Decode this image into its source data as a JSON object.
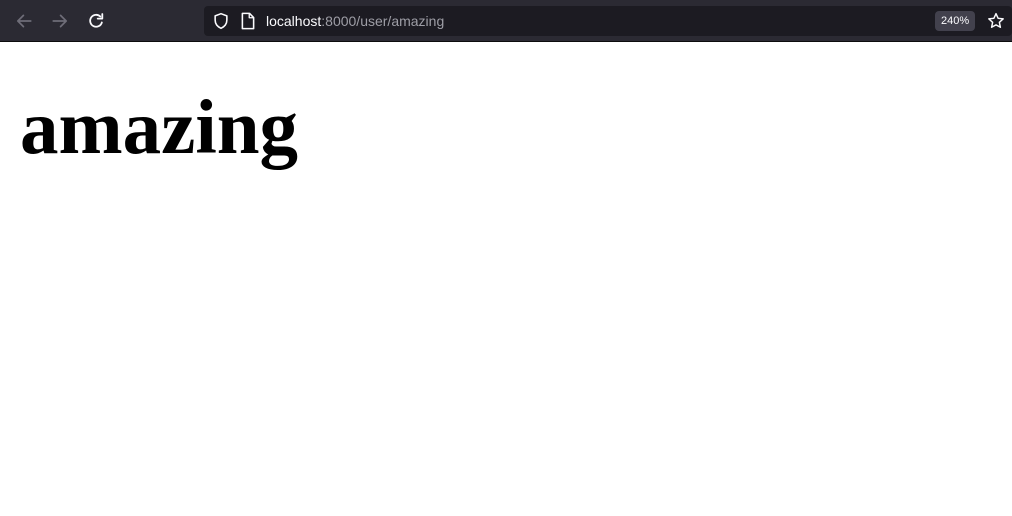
{
  "browser": {
    "url_host": "localhost",
    "url_path": ":8000/user/amazing",
    "zoom_label": "240%",
    "icons": {
      "back": "back-arrow-icon",
      "forward": "forward-arrow-icon",
      "reload": "reload-icon",
      "tracking": "shield-icon",
      "page": "page-icon",
      "bookmark": "star-icon"
    }
  },
  "page": {
    "heading": "amazing"
  },
  "colors": {
    "toolbar_bg": "#2b2a33",
    "urlbar_bg": "#1c1b22",
    "page_bg": "#ffffff",
    "heading_text": "#000000"
  }
}
